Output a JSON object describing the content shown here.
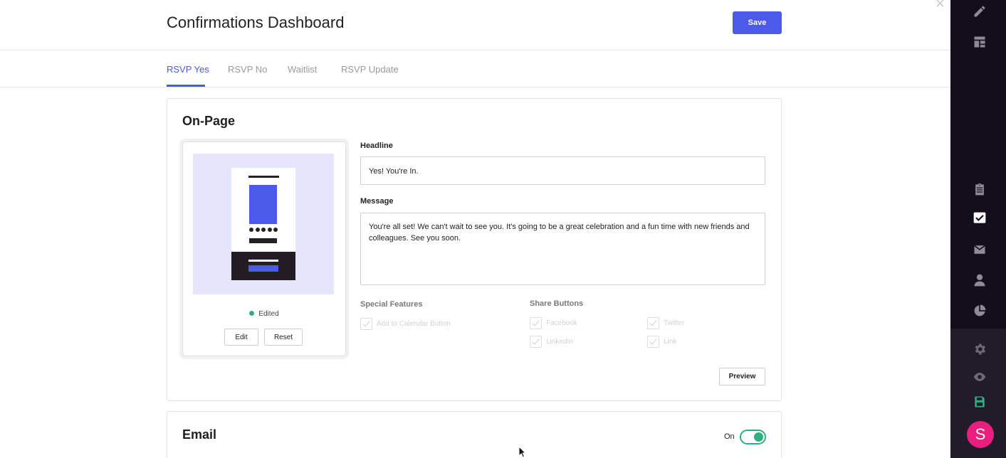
{
  "header": {
    "title": "Confirmations Dashboard",
    "save_label": "Save",
    "close_glyph": "×"
  },
  "tabs": [
    {
      "label": "RSVP Yes",
      "active": true
    },
    {
      "label": "RSVP No",
      "active": false
    },
    {
      "label": "Waitlist",
      "active": false
    },
    {
      "label": "RSVP Update",
      "active": false
    }
  ],
  "onpage": {
    "title": "On-Page",
    "preview": {
      "status": "Edited",
      "edit_label": "Edit",
      "reset_label": "Reset"
    },
    "headline_label": "Headline",
    "headline_value": "Yes! You're In.",
    "message_label": "Message",
    "message_value": "You're all set! We can't wait to see you. It's going to be a great celebration and a fun time with new friends and colleagues. See you soon.",
    "special_features_label": "Special Features",
    "special_features": [
      "Add to Calendar Button"
    ],
    "share_buttons_label": "Share Buttons",
    "share_buttons": [
      "Facebook",
      "Twitter",
      "LinkedIn",
      "Link"
    ],
    "preview_label": "Preview"
  },
  "email": {
    "title": "Email",
    "toggle_label": "On",
    "toggle_on": true
  },
  "sidebar": {
    "icons": [
      "pencil-icon",
      "layout-icon",
      "clipboard-icon",
      "checkbox-icon",
      "mail-icon",
      "user-icon",
      "pie-chart-icon",
      "gear-icon",
      "eye-icon",
      "save-icon"
    ],
    "avatar_initial": "S"
  },
  "colors": {
    "accent": "#4b5ae8",
    "success": "#2fb07f",
    "sidebar_bg": "#140d1c",
    "avatar": "#ea1e7c"
  }
}
